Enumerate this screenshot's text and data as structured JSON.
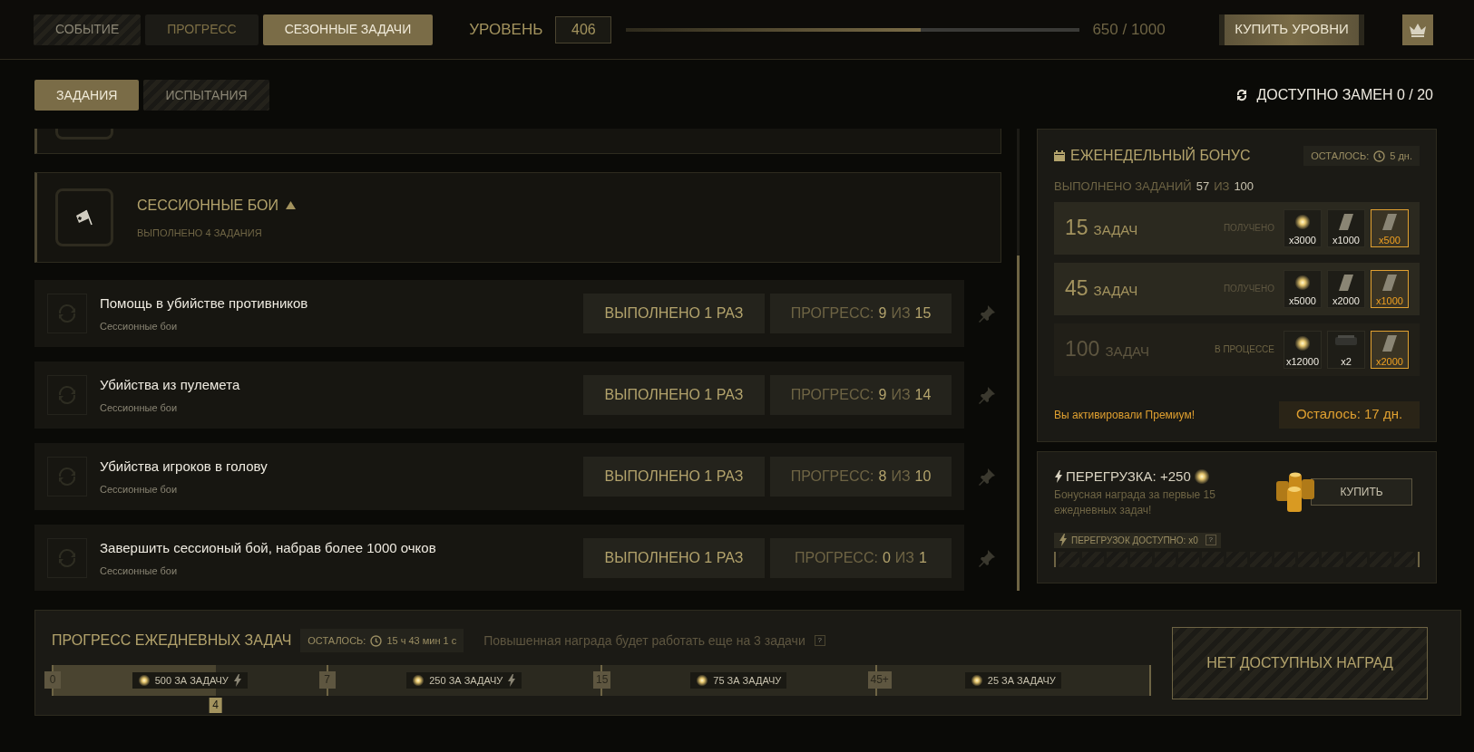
{
  "top_tabs": [
    {
      "label": "СОБЫТИЕ",
      "selected": false,
      "disabled": true
    },
    {
      "label": "ПРОГРЕСС",
      "selected": false,
      "disabled": false
    },
    {
      "label": "СЕЗОННЫЕ ЗАДАЧИ",
      "selected": true,
      "disabled": false
    }
  ],
  "level": {
    "label": "УРОВЕНЬ",
    "value": "406",
    "xp_bar": {
      "level": 0.65
    },
    "xp": "650 / 1000"
  },
  "buy_levels_button": "КУПИТЬ УРОВНИ",
  "sub_tabs": [
    {
      "label": "ЗАДАНИЯ",
      "selected": true,
      "disabled": false
    },
    {
      "label": "ИСПЫТАНИЯ",
      "selected": false,
      "disabled": true
    }
  ],
  "replacements": "ДОСТУПНО ЗАМЕН 0 / 20",
  "category": {
    "title": "СЕССИОННЫЕ БОИ",
    "expanded": true,
    "subtitle": "ВЫПОЛНЕНО 4 ЗАДАНИЯ"
  },
  "tasks": [
    {
      "title": "Помощь в убийстве противников",
      "subtitle": "Сессионные бои",
      "completed": "ВЫПОЛНЕНО 1 РАЗ",
      "progress": {
        "label": "ПРОГРЕСС:",
        "current": "9",
        "sep": "ИЗ",
        "total": "15"
      }
    },
    {
      "title": "Убийства из пулемета",
      "subtitle": "Сессионные бои",
      "completed": "ВЫПОЛНЕНО 1 РАЗ",
      "progress": {
        "label": "ПРОГРЕСС:",
        "current": "9",
        "sep": "ИЗ",
        "total": "14"
      }
    },
    {
      "title": "Убийства игроков в голову",
      "subtitle": "Сессионные бои",
      "completed": "ВЫПОЛНЕНО 1 РАЗ",
      "progress": {
        "label": "ПРОГРЕСС:",
        "current": "8",
        "sep": "ИЗ",
        "total": "10"
      }
    },
    {
      "title": "Завершить сессионый бой, набрав более 1000 очков",
      "subtitle": "Сессионные бои",
      "completed": "ВЫПОЛНЕНО 1 РАЗ",
      "progress": {
        "label": "ПРОГРЕСС:",
        "current": "0",
        "sep": "ИЗ",
        "total": "1"
      }
    }
  ],
  "weekly_bonus": {
    "title": "ЕЖЕНЕДЕЛЬНЫЙ БОНУС",
    "remaining_label": "ОСТАЛОСЬ:",
    "remaining": "5 дн.",
    "done": {
      "label": "ВЫПОЛНЕНО ЗАДАНИЙ",
      "current": "57",
      "sep": "ИЗ",
      "total": "100"
    },
    "tiers": [
      {
        "count": "15",
        "unit": "ЗАДАЧ",
        "status": "ПОЛУЧЕНО",
        "received": true,
        "rewards": [
          {
            "kind": "coin",
            "amount": "x3000",
            "premium": false
          },
          {
            "kind": "plate",
            "amount": "x1000",
            "premium": false
          },
          {
            "kind": "plate",
            "amount": "x500",
            "premium": true
          }
        ]
      },
      {
        "count": "45",
        "unit": "ЗАДАЧ",
        "status": "ПОЛУЧЕНО",
        "received": true,
        "rewards": [
          {
            "kind": "coin",
            "amount": "x5000",
            "premium": false
          },
          {
            "kind": "plate",
            "amount": "x2000",
            "premium": false
          },
          {
            "kind": "plate",
            "amount": "x1000",
            "premium": true
          }
        ]
      },
      {
        "count": "100",
        "unit": "ЗАДАЧ",
        "status": "В ПРОЦЕССЕ",
        "received": false,
        "rewards": [
          {
            "kind": "coin",
            "amount": "x12000",
            "premium": false
          },
          {
            "kind": "crate",
            "amount": "x2",
            "premium": false
          },
          {
            "kind": "plate",
            "amount": "x2000",
            "premium": true
          }
        ]
      }
    ],
    "premium_note": "Вы активировали Премиум!",
    "premium_remaining": "Осталось: 17 дн."
  },
  "overload": {
    "title": "ПЕРЕГРУЗКА: +250",
    "description": "Бонусная награда за первые 15 ежедневных задач!",
    "buy_button": "КУПИТЬ",
    "available": "ПЕРЕГРУЗОК ДОСТУПНО: x0",
    "help": "?",
    "level": 0
  },
  "daily": {
    "title": "ПРОГРЕСС ЕЖЕДНЕВНЫХ ЗАДАЧ",
    "remaining_label": "ОСТАЛОСЬ:",
    "remaining": "15 ч 43 мин 1 с",
    "note": "Повышенная награда будет работать еще на 3 задачи",
    "help": "?",
    "segments": [
      {
        "marker": "0",
        "reward": "500 ЗА ЗАДАЧУ",
        "boosted": true
      },
      {
        "marker": "7",
        "reward": "250 ЗА ЗАДАЧУ",
        "boosted": true
      },
      {
        "marker": "15",
        "reward": "75 ЗА ЗАДАЧУ",
        "boosted": false
      },
      {
        "marker": "45+",
        "reward": "25 ЗА ЗАДАЧУ",
        "boosted": false
      }
    ],
    "level": 0.149,
    "current": "4",
    "claim_button": "НЕТ ДОСТУПНЫХ НАГРАД"
  }
}
